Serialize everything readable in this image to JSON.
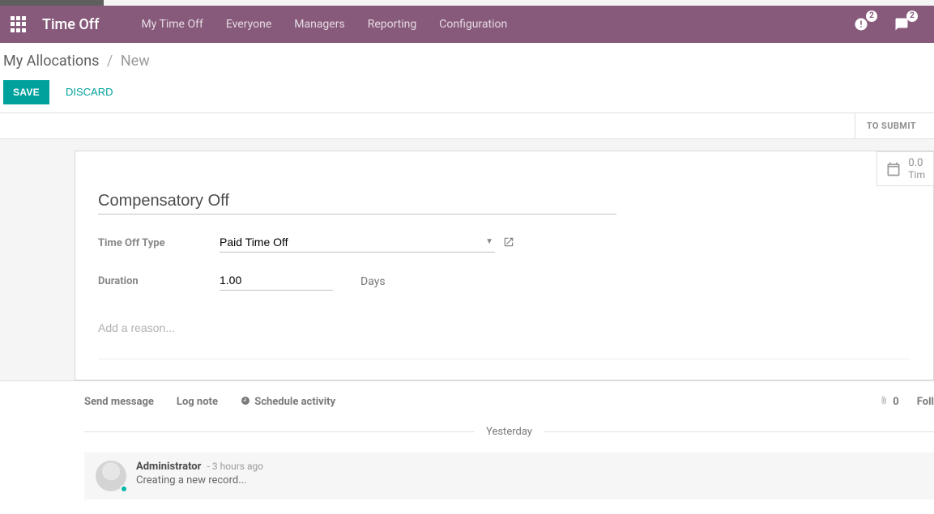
{
  "top": {
    "brand": "Time Off",
    "nav": [
      "My Time Off",
      "Everyone",
      "Managers",
      "Reporting",
      "Configuration"
    ],
    "activities_badge": "2",
    "messages_badge": "2"
  },
  "breadcrumb": {
    "parent": "My Allocations",
    "current": "New"
  },
  "buttons": {
    "save": "SAVE",
    "discard": "DISCARD"
  },
  "status": {
    "to_submit": "TO SUBMIT"
  },
  "statbox": {
    "value": "0.0",
    "label": "Tim"
  },
  "form": {
    "name": "Compensatory Off",
    "type_label": "Time Off Type",
    "type_value": "Paid Time Off",
    "duration_label": "Duration",
    "duration_value": "1.00",
    "duration_unit": "Days",
    "reason_placeholder": "Add a reason..."
  },
  "chatter": {
    "send": "Send message",
    "lognote": "Log note",
    "schedule": "Schedule activity",
    "attach_count": "0",
    "follow": "Foll",
    "separator": "Yesterday",
    "msg": {
      "author": "Administrator",
      "time": "- 3 hours ago",
      "body": "Creating a new record..."
    }
  }
}
